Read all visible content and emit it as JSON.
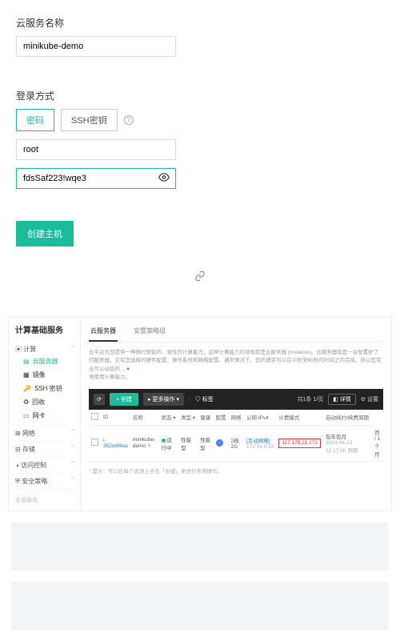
{
  "form": {
    "name_label": "云服务名称",
    "name_value": "minikube-demo",
    "login_label": "登录方式",
    "pw_tab": "密码",
    "ssh_tab": "SSH密钥",
    "user_value": "root",
    "password_value": "fdsSaf223!wqe3"
  },
  "create_btn": "创建主机",
  "console": {
    "side_title": "计算基础服务",
    "groups": {
      "compute": {
        "label": "计算",
        "items": [
          "云服务器",
          "镜像",
          "SSH 密钥",
          "回收",
          "网卡"
        ]
      },
      "network": "网络",
      "storage": "存储",
      "access": "访问控制",
      "security": "安全策略"
    },
    "side_note": "全部服务",
    "tabs": {
      "a": "云服务器",
      "b": "安置策略组"
    },
    "desc_a": "云平台为您提供一种随时获取的、弹性的计算能力，这种计算能力的体现就是云服务器 (Instance)。云服务器就是一台配置好了的服务器，它有您选择的硬件配置、操作系统和网络配置。通常情况下，您的请求可以在10秒到60秒的时间之内完成，所以您完全可以动态的…",
    "desc_b": "地使用计算能力。",
    "toolbar": {
      "new": "创建",
      "more": "更多操作",
      "filter": "标签",
      "pager": "共1条  1/页",
      "detail": "详情",
      "settings": "设置"
    },
    "table": {
      "headers": [
        "ID",
        "名称",
        "状态",
        "类型",
        "健康",
        "配置",
        "网络",
        "公网 IPv4",
        "计费模式",
        "自动续约/续费周期"
      ],
      "row": {
        "id": "i-352m49ea",
        "name": "minikube-demo",
        "status": "运行中",
        "type": "性能型",
        "perf": "性能型",
        "net_zone": "2核2G",
        "net_line1": "[互动网络]",
        "net_line2": "172.16.0.10",
        "ip": "117.175.21.171",
        "billing_line1": "包年包月",
        "billing_line2": "2024-06-23 12:17:00 到期",
        "renew": "否 / 1个月"
      }
    },
    "foot_tip": "* 提示：可以在每个资源上点击「右键」来进行常用操作。"
  }
}
